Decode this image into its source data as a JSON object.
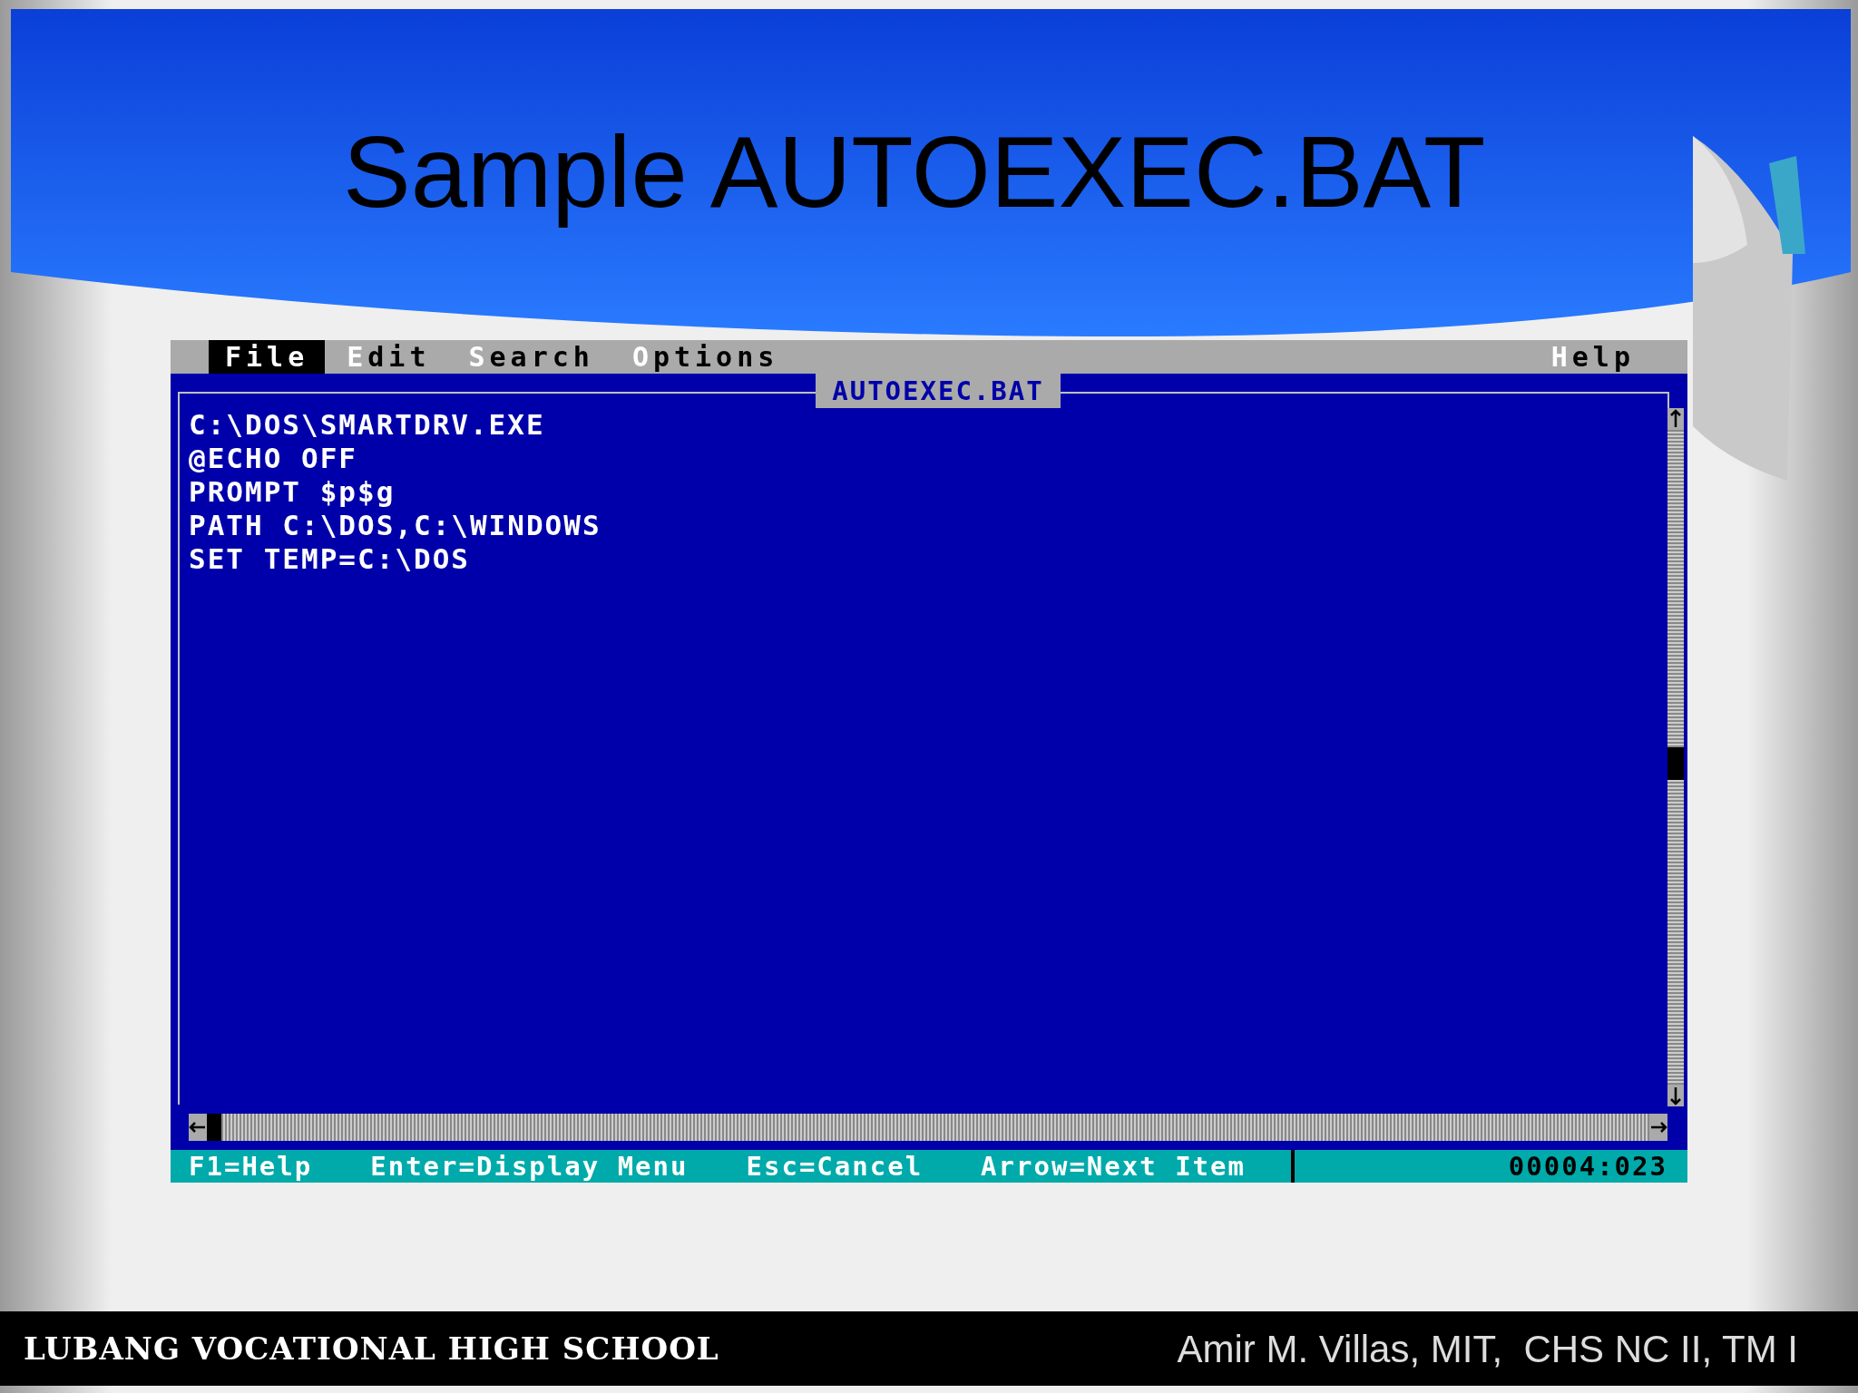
{
  "slide": {
    "title": "Sample AUTOEXEC.BAT"
  },
  "editor": {
    "menus": [
      {
        "label": "File",
        "selected": true
      },
      {
        "label": "Edit",
        "selected": false
      },
      {
        "label": "Search",
        "selected": false
      },
      {
        "label": "Options",
        "selected": false
      }
    ],
    "help_menu": {
      "label": "Help",
      "selected": false
    },
    "file_title": "AUTOEXEC.BAT",
    "lines": [
      "C:\\DOS\\SMARTDRV.EXE",
      "@ECHO OFF",
      "PROMPT $p$g",
      "PATH C:\\DOS,C:\\WINDOWS",
      "SET TEMP=C:\\DOS"
    ],
    "status_hints": [
      "F1=Help",
      "Enter=Display Menu",
      "Esc=Cancel",
      "Arrow=Next Item"
    ],
    "position": "00004:023"
  },
  "footer": {
    "school": "LUBANG VOCATIONAL HIGH SCHOOL",
    "author": "Amir M. Villas, MIT,  CHS NC II, TM I"
  }
}
